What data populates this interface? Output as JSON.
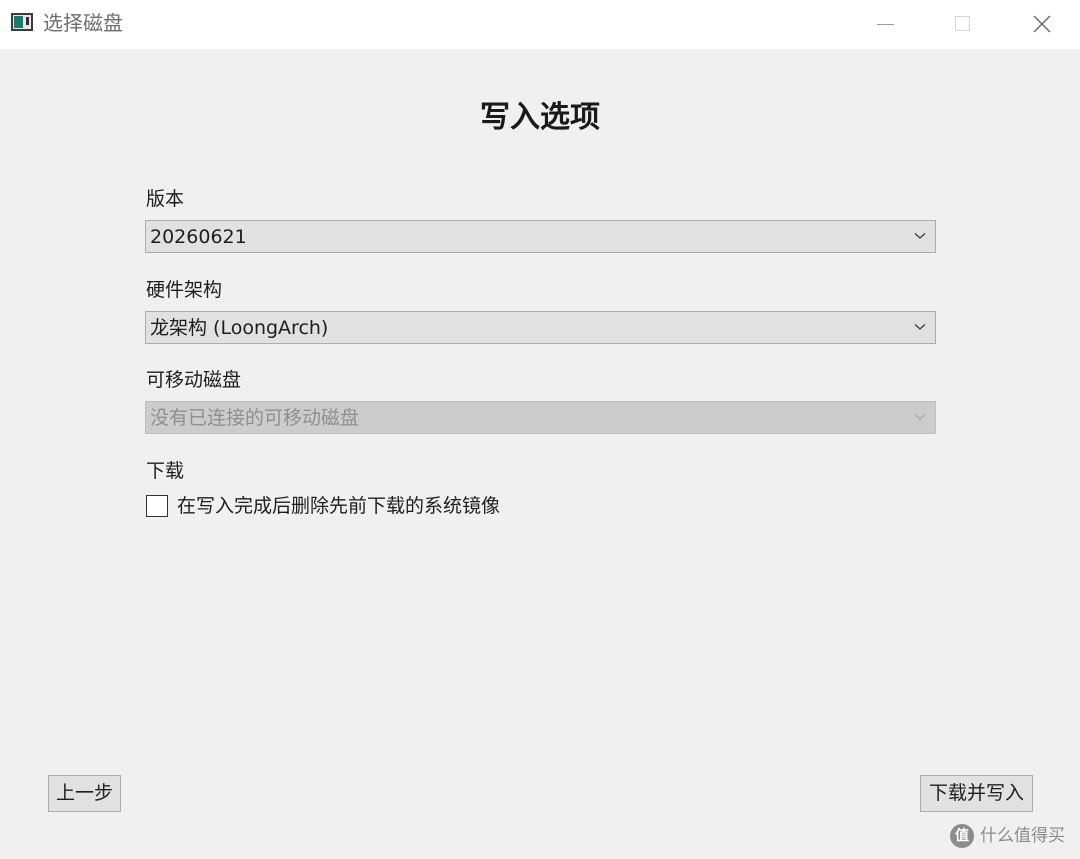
{
  "window": {
    "title": "选择磁盘",
    "icon": "app-window-icon"
  },
  "page": {
    "heading": "写入选项"
  },
  "version": {
    "label": "版本",
    "value": "20260621"
  },
  "arch": {
    "label": "硬件架构",
    "value": "龙架构 (LoongArch)"
  },
  "disk": {
    "label": "可移动磁盘",
    "value": "没有已连接的可移动磁盘",
    "enabled": false
  },
  "download": {
    "label": "下载",
    "checkbox_label": "在写入完成后删除先前下载的系统镜像",
    "checked": false
  },
  "footer": {
    "back_label": "上一步",
    "download_write_label": "下载并写入"
  },
  "watermark": {
    "logo": "值",
    "text": "什么值得买"
  },
  "colors": {
    "background": "#f0f0f0",
    "titlebar": "#ffffff",
    "control": "#e1e1e1",
    "disabled_control": "#cccccc",
    "disabled_text": "#8f8f8f"
  }
}
